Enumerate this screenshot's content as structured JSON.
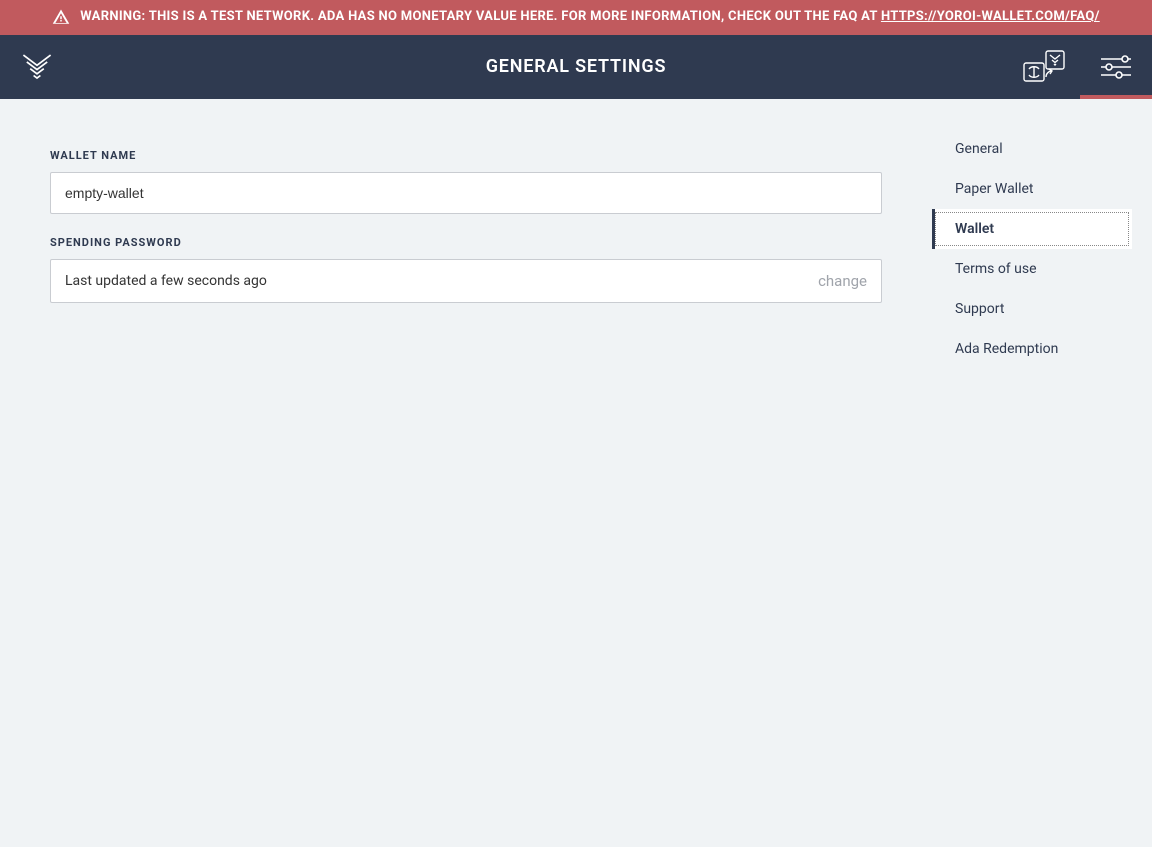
{
  "warning": {
    "prefix": "WARNING: THIS IS A TEST NETWORK. ADA HAS NO MONETARY VALUE HERE. FOR MORE INFORMATION, CHECK OUT THE FAQ AT ",
    "link_text": "HTTPS://YOROI-WALLET.COM/FAQ/"
  },
  "header": {
    "title": "GENERAL SETTINGS"
  },
  "form": {
    "wallet_name_label": "WALLET NAME",
    "wallet_name_value": "empty-wallet",
    "spending_password_label": "SPENDING PASSWORD",
    "spending_password_status": "Last updated a few seconds ago",
    "change_label": "change"
  },
  "sidebar": {
    "items": [
      {
        "label": "General"
      },
      {
        "label": "Paper Wallet"
      },
      {
        "label": "Wallet"
      },
      {
        "label": "Terms of use"
      },
      {
        "label": "Support"
      },
      {
        "label": "Ada Redemption"
      }
    ],
    "active_index": 2
  }
}
